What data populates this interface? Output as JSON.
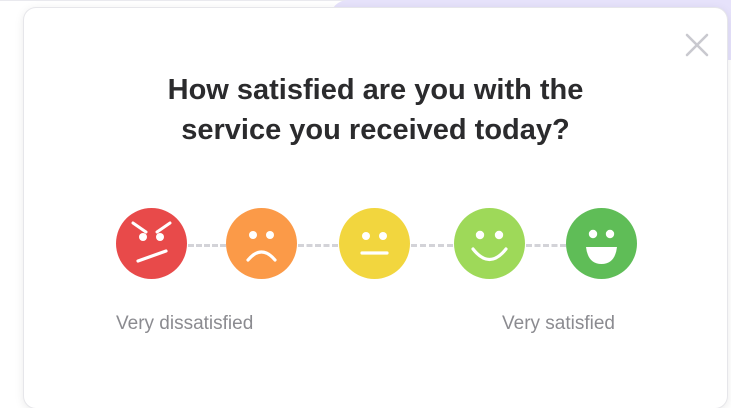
{
  "dialog": {
    "title_line1": "How satisfied are you with the",
    "title_line2": "service you received today?",
    "close_icon": "close-x-icon"
  },
  "rating": {
    "options": [
      {
        "name": "very-dissatisfied",
        "icon": "angry-face-icon",
        "color": "#e84a4a"
      },
      {
        "name": "dissatisfied",
        "icon": "frowning-face-icon",
        "color": "#fb9a48"
      },
      {
        "name": "neutral",
        "icon": "neutral-face-icon",
        "color": "#f2d63e"
      },
      {
        "name": "satisfied",
        "icon": "smiling-face-icon",
        "color": "#9ed959"
      },
      {
        "name": "very-satisfied",
        "icon": "grinning-face-icon",
        "color": "#5fbd57"
      }
    ],
    "low_label": "Very dissatisfied",
    "high_label": "Very satisfied"
  },
  "colors": {
    "backdrop_accent": "#e6e2fb",
    "title_text": "#2b2b2d",
    "label_text": "#8b8b90",
    "connector": "#d3d3d8",
    "close_icon": "#c9c9cf"
  }
}
